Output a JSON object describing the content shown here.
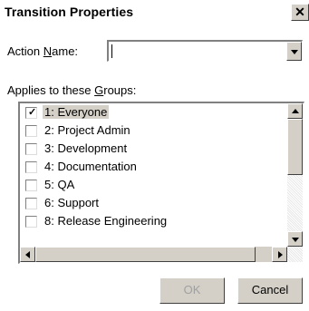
{
  "dialog": {
    "title": "Transition Properties",
    "close_icon": "close-icon"
  },
  "action_name": {
    "label_prefix": "Action ",
    "label_underlined": "N",
    "label_suffix": "ame:",
    "value": ""
  },
  "groups": {
    "label_prefix": "Applies to these ",
    "label_underlined": "G",
    "label_suffix": "roups:",
    "items": [
      {
        "label": "1: Everyone",
        "checked": true,
        "selected": true
      },
      {
        "label": "2: Project Admin",
        "checked": false,
        "selected": false
      },
      {
        "label": "3: Development",
        "checked": false,
        "selected": false
      },
      {
        "label": "4: Documentation",
        "checked": false,
        "selected": false
      },
      {
        "label": "5: QA",
        "checked": false,
        "selected": false
      },
      {
        "label": "6: Support",
        "checked": false,
        "selected": false
      },
      {
        "label": "8: Release Engineering",
        "checked": false,
        "selected": false
      }
    ]
  },
  "buttons": {
    "ok": "OK",
    "cancel": "Cancel",
    "ok_enabled": false
  },
  "colors": {
    "face": "#d4d0c8",
    "disabled_text": "#a0a0a0"
  }
}
